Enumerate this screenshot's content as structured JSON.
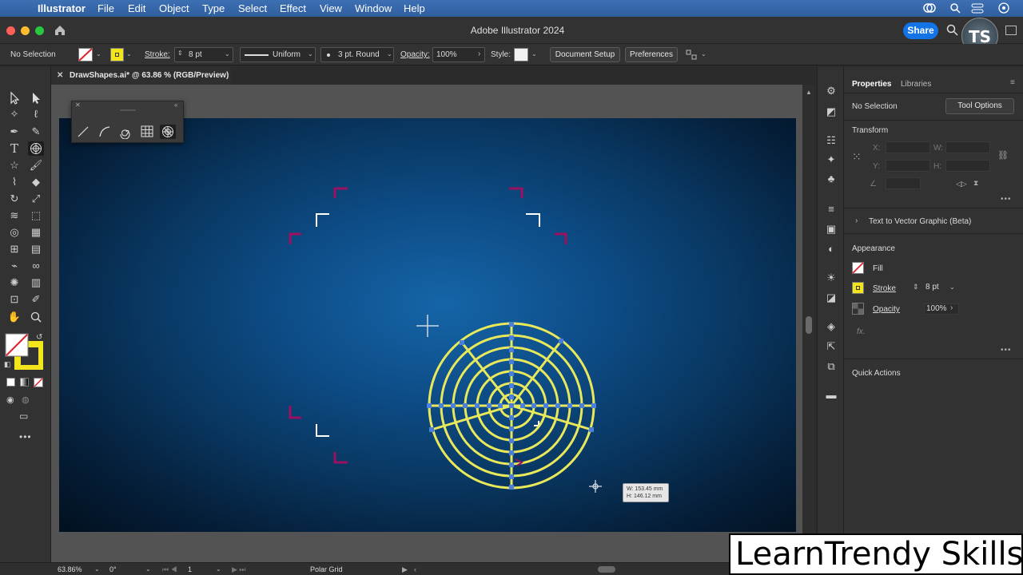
{
  "menubar": {
    "app_name": "Illustrator",
    "items": [
      "File",
      "Edit",
      "Object",
      "Type",
      "Select",
      "Effect",
      "View",
      "Window",
      "Help"
    ]
  },
  "titlebar": {
    "title": "Adobe Illustrator 2024",
    "share_label": "Share",
    "avatar_initials": "TS"
  },
  "controlbar": {
    "selection": "No Selection",
    "stroke_label": "Stroke:",
    "stroke_value": "8 pt",
    "profile": "Uniform",
    "brush": "3 pt. Round",
    "opacity_label": "Opacity:",
    "opacity_value": "100%",
    "style_label": "Style:",
    "document_setup": "Document Setup",
    "preferences": "Preferences"
  },
  "document": {
    "tab_title": "DrawShapes.ai* @ 63.86 % (RGB/Preview)"
  },
  "canvas": {
    "measure_w": "W: 153.45 mm",
    "measure_h": "H: 146.12 mm"
  },
  "properties": {
    "tabs": [
      "Properties",
      "Libraries"
    ],
    "selection": "No Selection",
    "tool_options": "Tool Options",
    "transform_heading": "Transform",
    "x_label": "X:",
    "y_label": "Y:",
    "w_label": "W:",
    "h_label": "H:",
    "text_to_vector": "Text to Vector Graphic (Beta)",
    "appearance_heading": "Appearance",
    "fill_label": "Fill",
    "stroke_label": "Stroke",
    "stroke_value": "8 pt",
    "opacity_label": "Opacity",
    "opacity_value": "100%",
    "fx_label": "fx.",
    "quick_actions": "Quick Actions"
  },
  "statusbar": {
    "zoom": "63.86%",
    "rotation": "0°",
    "artboard": "1",
    "tool_name": "Polar Grid"
  },
  "watermark": {
    "text": "LearnTrendy Skills"
  },
  "colors": {
    "accent_blue": "#1473e6",
    "stroke_yellow": "#e8e85a",
    "anchor_blue": "#4a7fe0",
    "crop_mark_magenta": "#9b1060"
  }
}
